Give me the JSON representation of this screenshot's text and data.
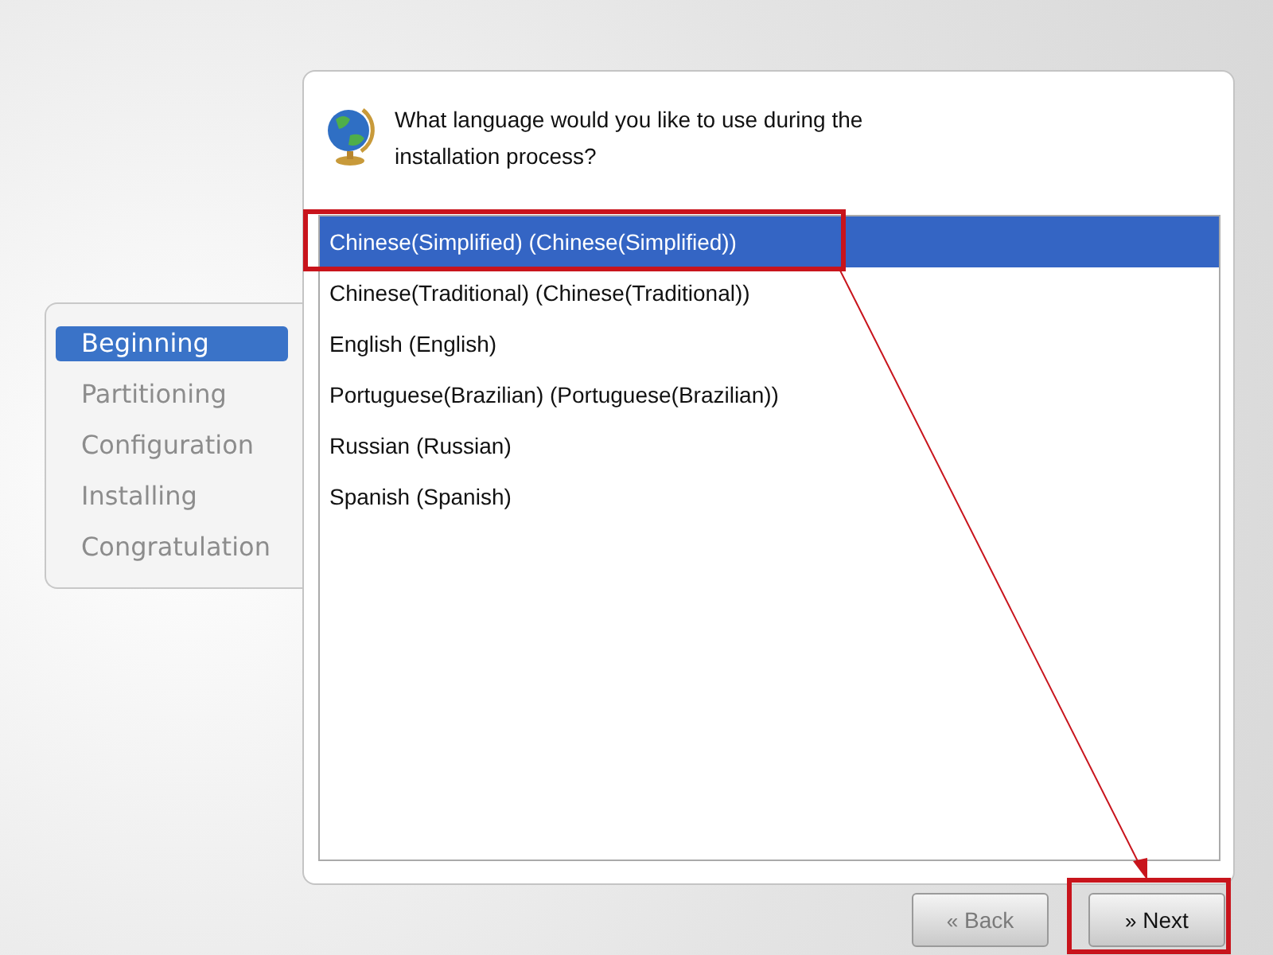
{
  "steps": [
    {
      "label": "Beginning",
      "selected": true
    },
    {
      "label": "Partitioning",
      "selected": false
    },
    {
      "label": "Configuration",
      "selected": false
    },
    {
      "label": "Installing",
      "selected": false
    },
    {
      "label": "Congratulation",
      "selected": false
    }
  ],
  "question": "What language would you like to use during the installation process?",
  "languages": [
    {
      "label": "Chinese(Simplified) (Chinese(Simplified))",
      "selected": true
    },
    {
      "label": "Chinese(Traditional) (Chinese(Traditional))",
      "selected": false
    },
    {
      "label": "English (English)",
      "selected": false
    },
    {
      "label": "Portuguese(Brazilian) (Portuguese(Brazilian))",
      "selected": false
    },
    {
      "label": "Russian (Russian)",
      "selected": false
    },
    {
      "label": "Spanish (Spanish)",
      "selected": false
    }
  ],
  "buttons": [
    {
      "icon": "«",
      "label": "Back",
      "disabled": true
    },
    {
      "icon": "»",
      "label": "Next",
      "disabled": false
    }
  ]
}
